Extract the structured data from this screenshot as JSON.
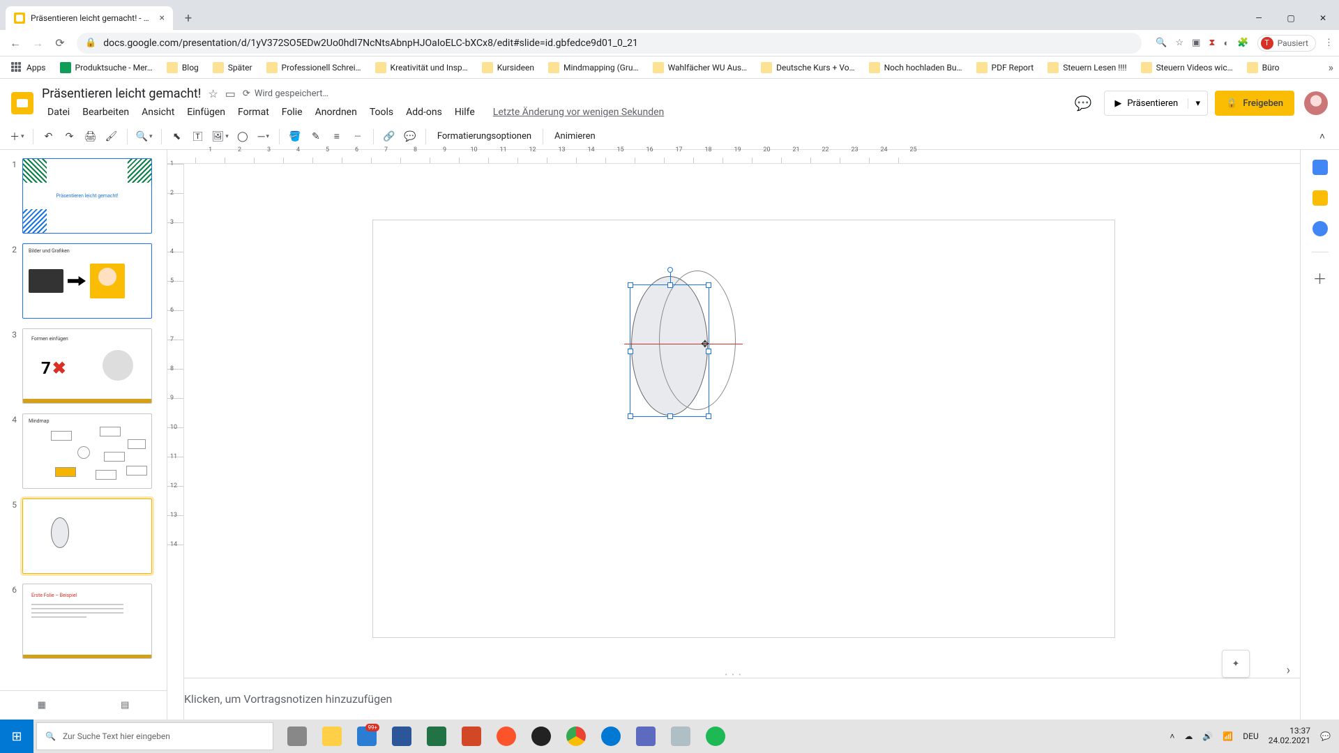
{
  "browser": {
    "tab_title": "Präsentieren leicht gemacht! - G…",
    "url": "docs.google.com/presentation/d/1yV372SO5EDw2Uo0hdI7NcNtsAbnpHJOaIoELC-bXCx8/edit#slide=id.gbfedce9d01_0_21",
    "profile_label": "Pausiert",
    "profile_initial": "T",
    "bookmarks": [
      {
        "label": "Apps",
        "kind": "apps"
      },
      {
        "label": "Produktsuche - Mer…",
        "kind": "green"
      },
      {
        "label": "Blog"
      },
      {
        "label": "Später"
      },
      {
        "label": "Professionell Schrei…"
      },
      {
        "label": "Kreativität und Insp…"
      },
      {
        "label": "Kursideen"
      },
      {
        "label": "Mindmapping  (Gru…"
      },
      {
        "label": "Wahlfächer WU Aus…"
      },
      {
        "label": "Deutsche Kurs + Vo…"
      },
      {
        "label": "Noch hochladen Bu…"
      },
      {
        "label": "PDF Report"
      },
      {
        "label": "Steuern Lesen !!!!"
      },
      {
        "label": "Steuern Videos wic…"
      },
      {
        "label": "Büro"
      }
    ]
  },
  "slides": {
    "doc_name": "Präsentieren leicht gemacht!",
    "saving": "Wird gespeichert…",
    "last_edit": "Letzte Änderung vor wenigen Sekunden",
    "menu": [
      "Datei",
      "Bearbeiten",
      "Ansicht",
      "Einfügen",
      "Format",
      "Folie",
      "Anordnen",
      "Tools",
      "Add-ons",
      "Hilfe"
    ],
    "toolbar_text": {
      "format_options": "Formatierungsoptionen",
      "animate": "Animieren"
    },
    "present": "Präsentieren",
    "share": "Freigeben",
    "speaker_notes_placeholder": "Klicken, um Vortragsnotizen hinzuzufügen",
    "ruler_h": [
      1,
      2,
      3,
      4,
      5,
      6,
      7,
      8,
      9,
      10,
      11,
      12,
      13,
      14,
      15,
      16,
      17,
      18,
      19,
      20,
      21,
      22,
      23,
      24,
      25
    ],
    "ruler_v": [
      1,
      2,
      3,
      4,
      5,
      6,
      7,
      8,
      9,
      10,
      11,
      12,
      13,
      14
    ],
    "thumbs": [
      {
        "num": "1",
        "title": "Präsentieren leicht gemacht!"
      },
      {
        "num": "2",
        "title": "Bilder und Grafiken"
      },
      {
        "num": "3",
        "title": "Formen einfügen",
        "big": "7"
      },
      {
        "num": "4",
        "title": "Mindmap"
      },
      {
        "num": "5",
        "title": ""
      },
      {
        "num": "6",
        "title": "Erste Folie – Beispiel"
      }
    ],
    "selected_thumb": 5
  },
  "taskbar": {
    "search_placeholder": "Zur Suche Text hier eingeben",
    "lang": "DEU",
    "time": "13:37",
    "date": "24.02.2021",
    "notif_badge": "99+"
  }
}
